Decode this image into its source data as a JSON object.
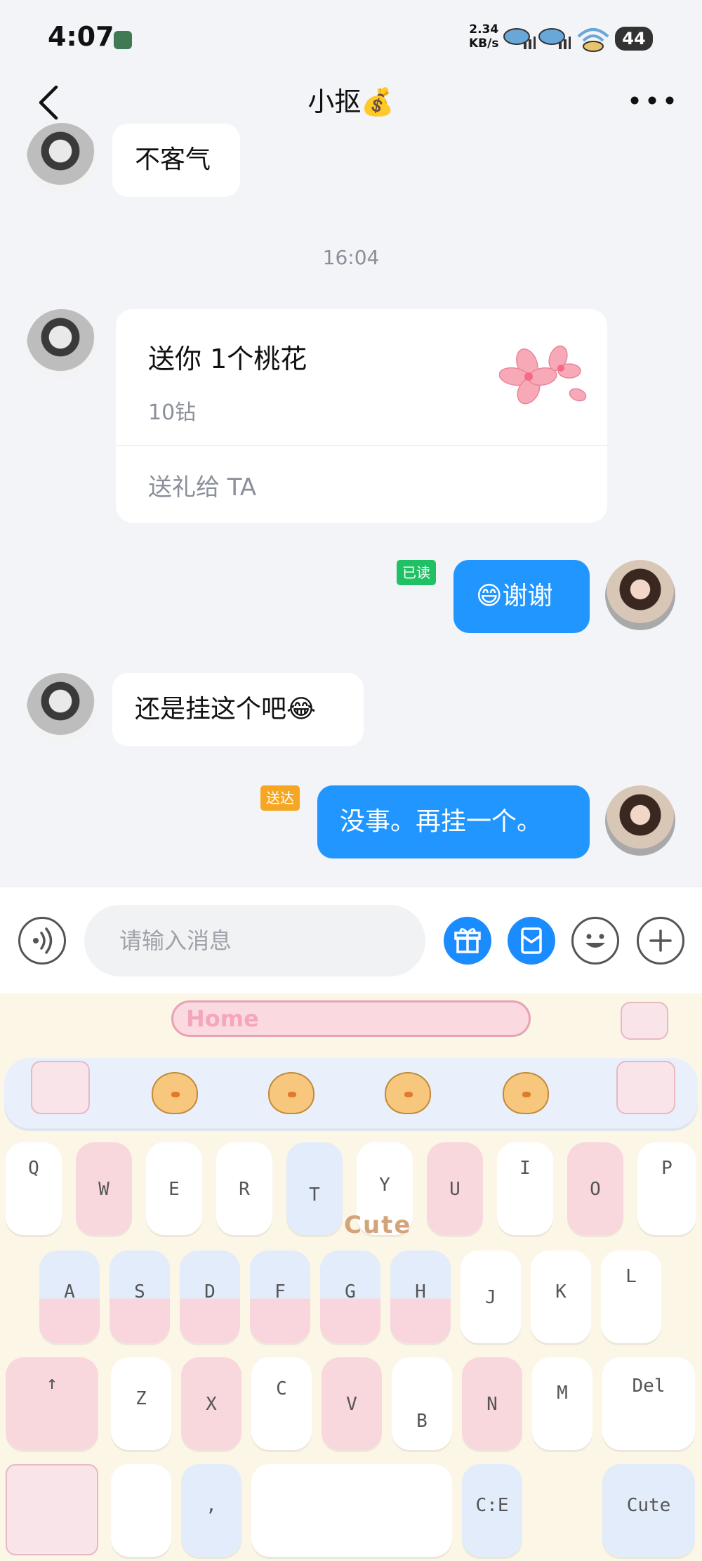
{
  "status_bar": {
    "time": "4:07",
    "net_speed_value": "2.34",
    "net_speed_unit": "KB/s",
    "battery": "44",
    "icons": [
      "signal-icon",
      "signal-icon",
      "wifi-icon",
      "battery-icon"
    ]
  },
  "header": {
    "title": "小抠💰",
    "back_icon": "chevron-left-icon",
    "more_icon": "more-dots-icon"
  },
  "messages": [
    {
      "side": "left",
      "type": "text",
      "text": "不客气"
    },
    {
      "type": "timestamp",
      "text": "16:04"
    },
    {
      "side": "left",
      "type": "gift",
      "title": "送你 1个桃花",
      "price": "10钻",
      "action": "送礼给 TA"
    },
    {
      "side": "right",
      "type": "text",
      "text": "😄谢谢",
      "status": "已读"
    },
    {
      "side": "left",
      "type": "text",
      "text": "还是挂这个吧😂"
    },
    {
      "side": "right",
      "type": "text",
      "text": "没事。再挂一个。",
      "status": "送达"
    }
  ],
  "input_bar": {
    "placeholder": "请输入消息",
    "icons": [
      "voice-icon",
      "gift-icon",
      "red-packet-icon",
      "emoji-icon",
      "plus-icon"
    ]
  },
  "keyboard": {
    "banner": "Home",
    "theme_text": "Cute",
    "rows": [
      [
        "Q",
        "W",
        "E",
        "R",
        "T",
        "Y",
        "U",
        "I",
        "O",
        "P"
      ],
      [
        "A",
        "S",
        "D",
        "F",
        "G",
        "H",
        "J",
        "K",
        "L"
      ],
      [
        "↑",
        "Z",
        "X",
        "C",
        "V",
        "B",
        "N",
        "M",
        "Del"
      ],
      [
        ",",
        "C:E",
        "Cute"
      ]
    ]
  }
}
